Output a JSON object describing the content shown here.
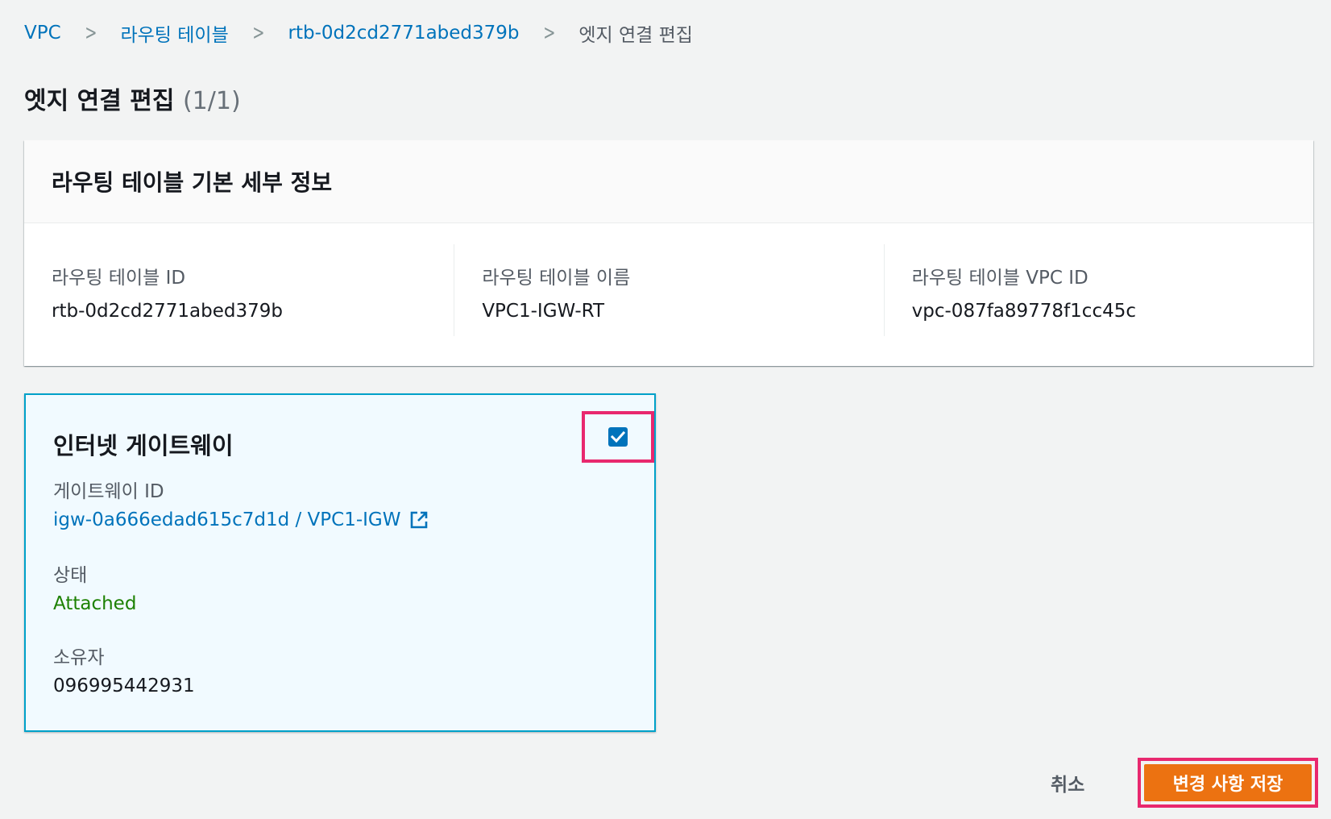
{
  "breadcrumb": {
    "items": [
      "VPC",
      "라우팅 테이블",
      "rtb-0d2cd2771abed379b"
    ],
    "current": "엣지 연결 편집"
  },
  "page": {
    "title": "엣지 연결 편집",
    "count": "(1/1)"
  },
  "details": {
    "heading": "라우팅 테이블 기본 세부 정보",
    "fields": [
      {
        "label": "라우팅 테이블 ID",
        "value": "rtb-0d2cd2771abed379b"
      },
      {
        "label": "라우팅 테이블 이름",
        "value": "VPC1-IGW-RT"
      },
      {
        "label": "라우팅 테이블 VPC ID",
        "value": "vpc-087fa89778f1cc45c"
      }
    ]
  },
  "gateway": {
    "title": "인터넷 게이트웨이",
    "checked": true,
    "id_label": "게이트웨이 ID",
    "id_value": "igw-0a666edad615c7d1d / VPC1-IGW",
    "status_label": "상태",
    "status_value": "Attached",
    "owner_label": "소유자",
    "owner_value": "096995442931"
  },
  "actions": {
    "cancel_label": "취소",
    "save_label": "변경 사항 저장"
  },
  "colors": {
    "link": "#0073bb",
    "primary": "#ec7211",
    "highlight": "#e8286e",
    "success": "#1d8102"
  },
  "icons": [
    "chevron-right-icon",
    "checkbox-checked-icon",
    "external-link-icon"
  ]
}
